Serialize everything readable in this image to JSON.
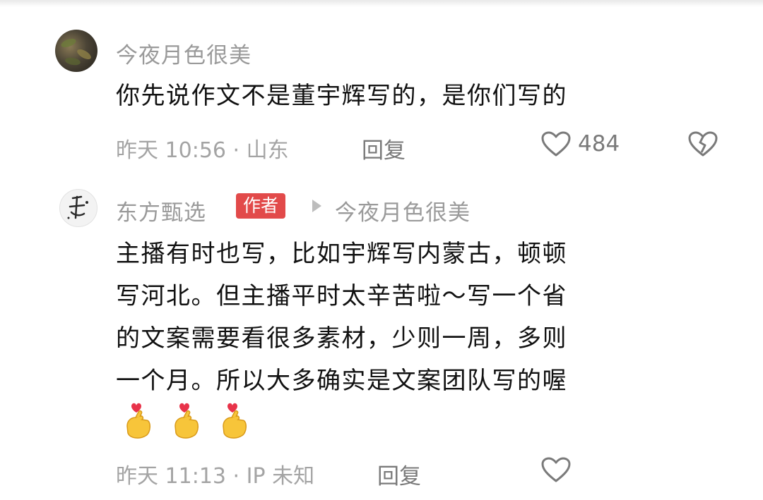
{
  "comments": [
    {
      "username": "今夜月色很美",
      "text_lines": [
        "你先说作文不是董宇辉写的，是你们写的"
      ],
      "meta": "昨天 10:56 · 山东",
      "reply_label": "回复",
      "like_count": "484"
    },
    {
      "username": "东方甄选",
      "author_badge": "作者",
      "reply_to": "今夜月色很美",
      "text_lines": [
        "主播有时也写，比如宇辉写内蒙古，顿顿",
        "写河北。但主播平时太辛苦啦～写一个省",
        "的文案需要看很多素材，少则一周，多则",
        "一个月。所以大多确实是文案团队写的喔"
      ],
      "emojis": [
        "finger-heart-emoji",
        "finger-heart-emoji",
        "finger-heart-emoji"
      ],
      "meta": "昨天 11:13 · IP 未知",
      "reply_label": "回复"
    }
  ],
  "icons": {
    "like": "heart-outline-icon",
    "dislike": "broken-heart-icon"
  },
  "colors": {
    "author_badge": "#e24a4a",
    "secondary_text": "#9a9a9a",
    "primary_text": "#111111"
  }
}
